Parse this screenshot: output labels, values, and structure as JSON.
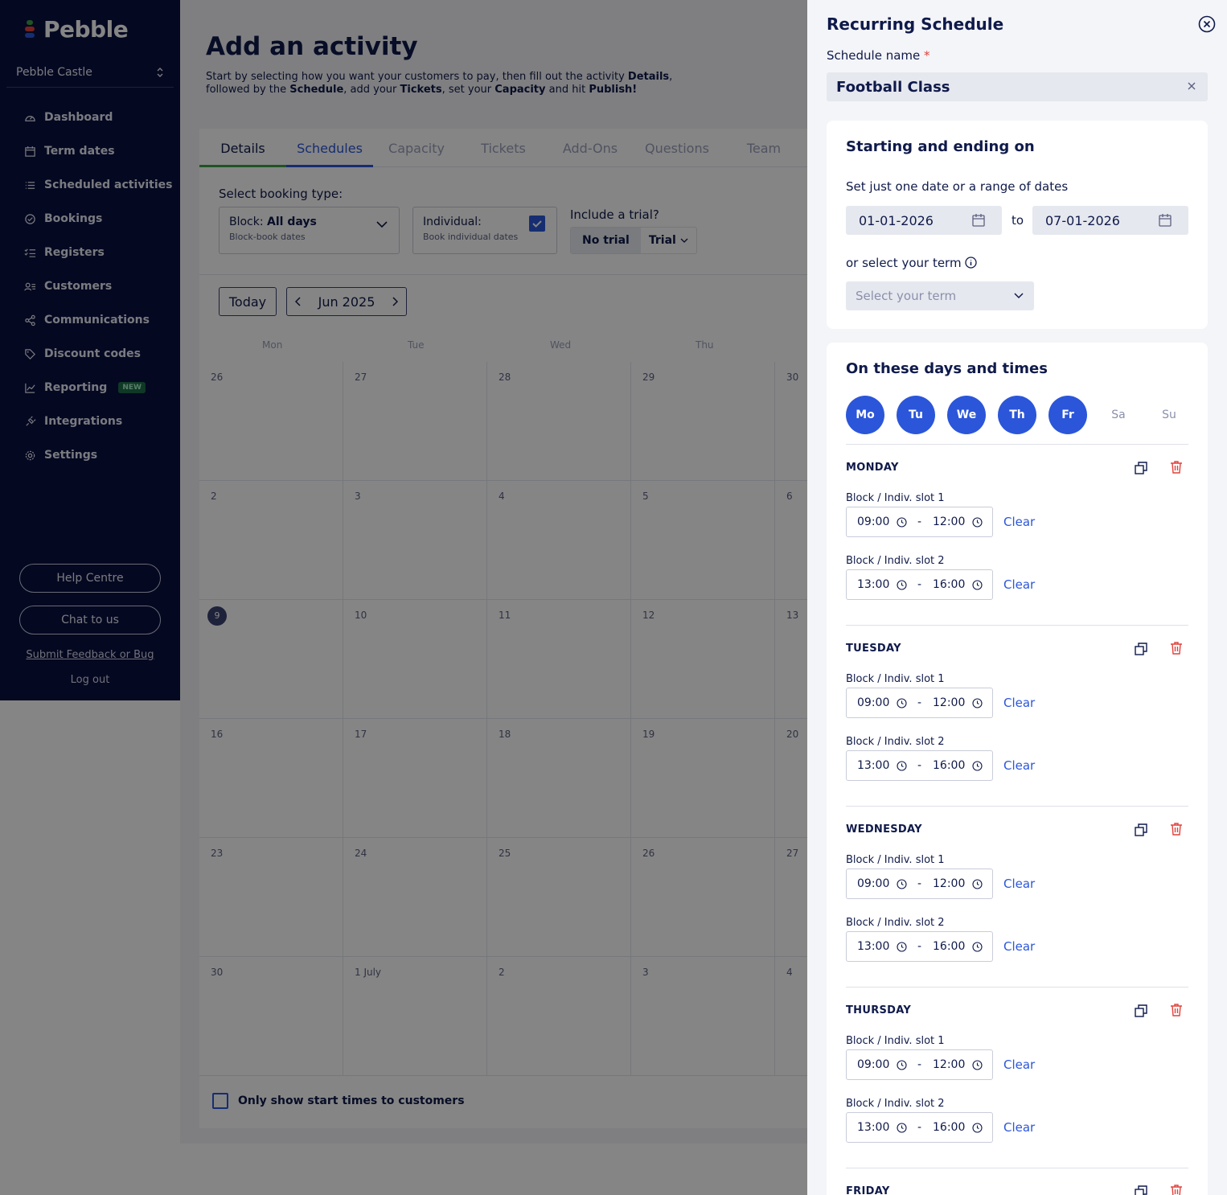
{
  "sidebar": {
    "brand": "Pebble",
    "org": "Pebble Castle",
    "items": [
      {
        "label": "Dashboard",
        "icon": "gauge-icon"
      },
      {
        "label": "Term dates",
        "icon": "calendar-icon"
      },
      {
        "label": "Scheduled activities",
        "icon": "list-icon"
      },
      {
        "label": "Bookings",
        "icon": "check-circle-icon"
      },
      {
        "label": "Registers",
        "icon": "checklist-icon"
      },
      {
        "label": "Customers",
        "icon": "users-icon"
      },
      {
        "label": "Communications",
        "icon": "share-icon"
      },
      {
        "label": "Discount codes",
        "icon": "tag-icon"
      },
      {
        "label": "Reporting",
        "icon": "chart-icon",
        "badge": "NEW"
      },
      {
        "label": "Integrations",
        "icon": "plug-icon"
      },
      {
        "label": "Settings",
        "icon": "gear-icon"
      }
    ],
    "help": "Help Centre",
    "chat": "Chat to us",
    "feedback": "Submit Feedback or Bug",
    "logout": "Log out"
  },
  "page": {
    "title": "Add an activity",
    "subtitle_parts": [
      "Start by selecting how you want your customers to pay, then fill out the activity ",
      "Details",
      ",",
      "followed by the ",
      "Schedule",
      ", add your ",
      "Tickets",
      ", set your ",
      "Capacity",
      " and hit ",
      "Publish!"
    ]
  },
  "tabs": [
    "Details",
    "Schedules",
    "Capacity",
    "Tickets",
    "Add-Ons",
    "Questions",
    "Team"
  ],
  "booking": {
    "label": "Select booking type:",
    "block_prefix": "Block:",
    "block_value": "All days",
    "block_sub": "Block-book dates",
    "individual": "Individual:",
    "individual_sub": "Book individual dates",
    "trial_label": "Include a trial?",
    "no_trial": "No trial",
    "trial": "Trial"
  },
  "calendar": {
    "today": "Today",
    "month": "Jun 2025",
    "weekdays": [
      "Mon",
      "Tue",
      "Wed",
      "Thu"
    ],
    "weeks": [
      [
        "26",
        "27",
        "28",
        "29",
        "30"
      ],
      [
        "2",
        "3",
        "4",
        "5",
        "6"
      ],
      [
        "9",
        "10",
        "11",
        "12",
        "13"
      ],
      [
        "16",
        "17",
        "18",
        "19",
        "20"
      ],
      [
        "23",
        "24",
        "25",
        "26",
        "27"
      ],
      [
        "30",
        "1 July",
        "2",
        "3",
        "4"
      ]
    ],
    "only_start": "Only show start times to customers"
  },
  "drawer": {
    "title": "Recurring Schedule",
    "name_label": "Schedule name",
    "required_mark": "*",
    "name_value": "Football Class",
    "range_title": "Starting and ending on",
    "range_hint": "Set just one date or a range of dates",
    "start_date": "01-01-2026",
    "to": "to",
    "end_date": "07-01-2026",
    "term_hint": "or select your term",
    "term_placeholder": "Select your term",
    "days_title": "On these days and times",
    "day_pills": [
      {
        "label": "Mo",
        "on": true
      },
      {
        "label": "Tu",
        "on": true
      },
      {
        "label": "We",
        "on": true
      },
      {
        "label": "Th",
        "on": true
      },
      {
        "label": "Fr",
        "on": true
      },
      {
        "label": "Sa",
        "on": false
      },
      {
        "label": "Su",
        "on": false
      }
    ],
    "days": [
      {
        "name": "MONDAY",
        "slots": [
          {
            "label": "Block / Indiv. slot 1",
            "start": "09:00",
            "end": "12:00"
          },
          {
            "label": "Block / Indiv. slot 2",
            "start": "13:00",
            "end": "16:00"
          }
        ]
      },
      {
        "name": "TUESDAY",
        "slots": [
          {
            "label": "Block / Indiv. slot 1",
            "start": "09:00",
            "end": "12:00"
          },
          {
            "label": "Block / Indiv. slot 2",
            "start": "13:00",
            "end": "16:00"
          }
        ]
      },
      {
        "name": "WEDNESDAY",
        "slots": [
          {
            "label": "Block / Indiv. slot 1",
            "start": "09:00",
            "end": "12:00"
          },
          {
            "label": "Block / Indiv. slot 2",
            "start": "13:00",
            "end": "16:00"
          }
        ]
      },
      {
        "name": "THURSDAY",
        "slots": [
          {
            "label": "Block / Indiv. slot 1",
            "start": "09:00",
            "end": "12:00"
          },
          {
            "label": "Block / Indiv. slot 2",
            "start": "13:00",
            "end": "16:00"
          }
        ]
      },
      {
        "name": "FRIDAY",
        "slots": []
      }
    ],
    "dash": "-",
    "clear": "Clear"
  },
  "colors": {
    "navy": "#0b1140",
    "primary": "#2b56d9",
    "danger": "#e0413b",
    "success": "#3fa046"
  }
}
